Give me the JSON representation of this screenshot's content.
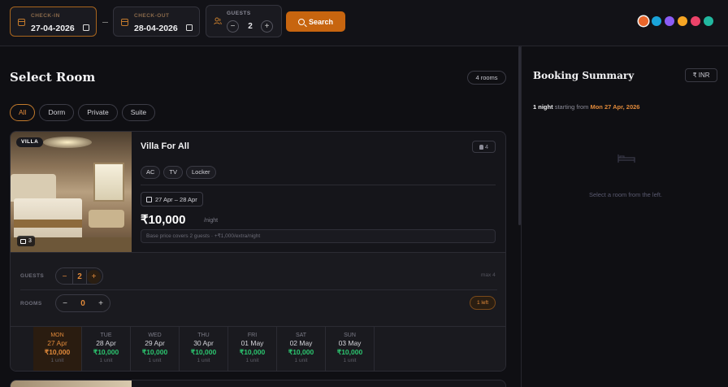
{
  "search": {
    "checkin_label": "CHECK-IN",
    "checkin_value": "27-04-2026",
    "checkout_label": "CHECK-OUT",
    "checkout_value": "28-04-2026",
    "guests_label": "GUESTS",
    "guests_value": "2",
    "minus": "−",
    "plus": "+",
    "separator": "–",
    "search_label": "Search"
  },
  "theme_swatches": [
    "#e8652a",
    "#1aa3d9",
    "#8b5cf6",
    "#f5a524",
    "#ec4369",
    "#22b8a0"
  ],
  "rooms_header": {
    "title": "Select Room",
    "count": "4 rooms"
  },
  "filters": [
    {
      "label": "All",
      "active": true
    },
    {
      "label": "Dorm",
      "active": false
    },
    {
      "label": "Private",
      "active": false
    },
    {
      "label": "Suite",
      "active": false
    }
  ],
  "room": {
    "type_badge": "VILLA",
    "photo_count": "3",
    "name": "Villa For All",
    "occupancy": "4",
    "amenities": [
      "AC",
      "TV",
      "Locker"
    ],
    "date_range": "27 Apr – 28 Apr",
    "price": "₹10,000",
    "per": "/night",
    "note": "Base price covers 2 guests · +₹1,000/extra/night",
    "guests_label": "GUESTS",
    "guests_value": "2",
    "max_label": "max 4",
    "rooms_label": "ROOMS",
    "rooms_value": "0",
    "left_label": "1 left",
    "days": [
      {
        "dow": "MON",
        "date": "27 Apr",
        "price": "₹10,000",
        "unit": "1 unit"
      },
      {
        "dow": "TUE",
        "date": "28 Apr",
        "price": "₹10,000",
        "unit": "1 unit"
      },
      {
        "dow": "WED",
        "date": "29 Apr",
        "price": "₹10,000",
        "unit": "1 unit"
      },
      {
        "dow": "THU",
        "date": "30 Apr",
        "price": "₹10,000",
        "unit": "1 unit"
      },
      {
        "dow": "FRI",
        "date": "01 May",
        "price": "₹10,000",
        "unit": "1 unit"
      },
      {
        "dow": "SAT",
        "date": "02 May",
        "price": "₹10,000",
        "unit": "1 unit"
      },
      {
        "dow": "SUN",
        "date": "03 May",
        "price": "₹10,000",
        "unit": "1 unit"
      }
    ]
  },
  "summary": {
    "title": "Booking Summary",
    "currency": "₹ INR",
    "nights": "1 night",
    "starting_from": "starting from",
    "start_date": "Mon 27 Apr, 2026",
    "empty_text": "Select a room from the left."
  }
}
